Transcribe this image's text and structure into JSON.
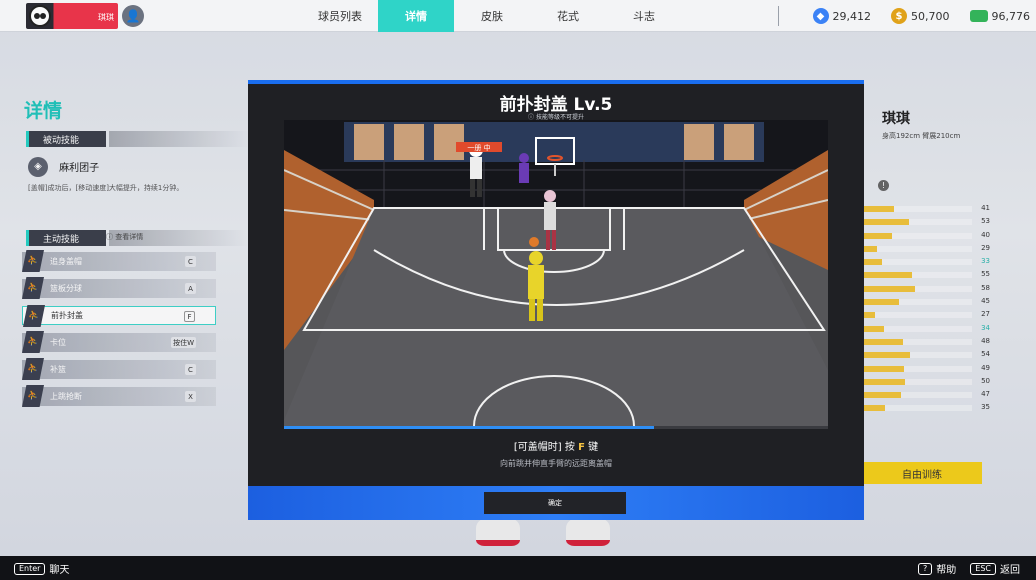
{
  "topbar": {
    "username": "琪琪",
    "tabs": [
      "球员列表",
      "详情",
      "皮肤",
      "花式",
      "斗志"
    ],
    "active_tab": 1,
    "currencies": [
      {
        "icon": "gem-icon",
        "value": "29,412"
      },
      {
        "icon": "gold-coin-icon",
        "value": "50,700"
      },
      {
        "icon": "cash-icon",
        "value": "96,776"
      }
    ]
  },
  "left": {
    "title": "详情",
    "passive_header": "被动技能",
    "passive_name": "麻利团子",
    "passive_desc": "[盖帽]成功后，[移动速度]大幅提升，持续1分钟。",
    "active_header": "主动技能",
    "view_detail": "查看详情",
    "skills": [
      {
        "name": "追身盖帽",
        "key": "C"
      },
      {
        "name": "篮板分球",
        "key": "A"
      },
      {
        "name": "前扑封盖",
        "key": "F"
      },
      {
        "name": "卡位",
        "key": "按住W"
      },
      {
        "name": "补篮",
        "key": "C"
      },
      {
        "name": "上跳抢断",
        "key": "X"
      }
    ],
    "active_skill": 2
  },
  "right": {
    "player_name": "琪琪",
    "player_stats": "身高192cm  臂展210cm",
    "attrs": [
      {
        "value": "41",
        "level": 0.3
      },
      {
        "value": "53",
        "level": 0.44
      },
      {
        "value": "40",
        "level": 0.29
      },
      {
        "value": "29",
        "level": 0.15
      },
      {
        "value": "33",
        "level": 0.2,
        "highlight": true
      },
      {
        "value": "55",
        "level": 0.46
      },
      {
        "value": "58",
        "level": 0.49
      },
      {
        "value": "45",
        "level": 0.35
      },
      {
        "value": "27",
        "level": 0.13
      },
      {
        "value": "34",
        "level": 0.21,
        "highlight": true
      },
      {
        "value": "48",
        "level": 0.38
      },
      {
        "value": "54",
        "level": 0.45
      },
      {
        "value": "49",
        "level": 0.39
      },
      {
        "value": "50",
        "level": 0.4
      },
      {
        "value": "47",
        "level": 0.37
      },
      {
        "value": "35",
        "level": 0.22
      }
    ],
    "free_train": "自由训练"
  },
  "modal": {
    "title": "前扑封盖 Lv.5",
    "subtitle": "技能等级不可提升",
    "video_tag": "一册 中",
    "progress": 0.68,
    "hint_prefix": "[可盖帽时] 按 ",
    "hint_key": "F",
    "hint_suffix": " 键",
    "hint_desc": "向前跳并伸直手臂的远距离盖帽",
    "confirm": "确定"
  },
  "bottombar": {
    "chat_key": "Enter",
    "chat_label": "聊天",
    "help_key": "?",
    "help_label": "帮助",
    "back_key": "ESC",
    "back_label": "返回"
  },
  "colors": {
    "accent": "#2fd4c8",
    "modal_blue": "#1a6ef0",
    "attr_fill": "#f2c43a",
    "free_train": "#f6d119"
  }
}
